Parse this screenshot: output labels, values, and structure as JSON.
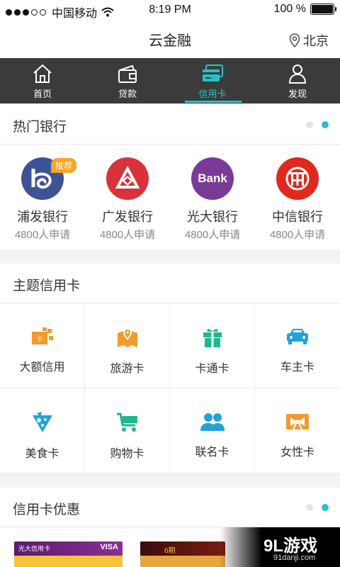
{
  "status_bar": {
    "carrier": "中国移动",
    "time": "8:19 PM",
    "battery": "100 %"
  },
  "header": {
    "title": "云金融",
    "city": "北京"
  },
  "tabs": [
    {
      "label": "首页",
      "icon": "home-icon",
      "active": false
    },
    {
      "label": "贷款",
      "icon": "wallet-icon",
      "active": false
    },
    {
      "label": "信用卡",
      "icon": "credit-card-icon",
      "active": true
    },
    {
      "label": "发现",
      "icon": "person-icon",
      "active": false
    }
  ],
  "hot_banks": {
    "title": "热门银行",
    "items": [
      {
        "name": "浦发银行",
        "count": "4800人申请",
        "badge": "推荐",
        "color": "#3e5396",
        "icon": "spdb-logo"
      },
      {
        "name": "广发银行",
        "count": "4800人申请",
        "color": "#d8323c",
        "icon": "cgb-logo"
      },
      {
        "name": "光大银行",
        "count": "4800人申请",
        "color": "#7a3b98",
        "icon": "ceb-logo",
        "logo_text": "Bank"
      },
      {
        "name": "中信银行",
        "count": "4800人申请",
        "color": "#e0281f",
        "icon": "citic-logo"
      }
    ]
  },
  "theme_cards": {
    "title": "主题信用卡",
    "items": [
      {
        "name": "大额信用",
        "icon": "large-credit-icon",
        "color": "#f39a2e"
      },
      {
        "name": "旅游卡",
        "icon": "map-pin-icon",
        "color": "#f39a2e"
      },
      {
        "name": "卡通卡",
        "icon": "gift-icon",
        "color": "#1fb88e"
      },
      {
        "name": "车主卡",
        "icon": "car-icon",
        "color": "#22a3d6"
      },
      {
        "name": "美食卡",
        "icon": "food-icon",
        "color": "#22a3d6"
      },
      {
        "name": "购物卡",
        "icon": "cart-icon",
        "color": "#1fb88e"
      },
      {
        "name": "联名卡",
        "icon": "people-icon",
        "color": "#22a3d6"
      },
      {
        "name": "女性卡",
        "icon": "bow-icon",
        "color": "#f39a2e"
      }
    ]
  },
  "card_offers": {
    "title": "信用卡优惠",
    "card1_brand": "光大信用卡",
    "card1_network": "VISA",
    "card2_label": "6期"
  },
  "watermark": {
    "logo": "9L游戏",
    "url": "91danji.com"
  },
  "colors": {
    "accent": "#25c2c6",
    "tabbar": "#3b3b3b"
  }
}
